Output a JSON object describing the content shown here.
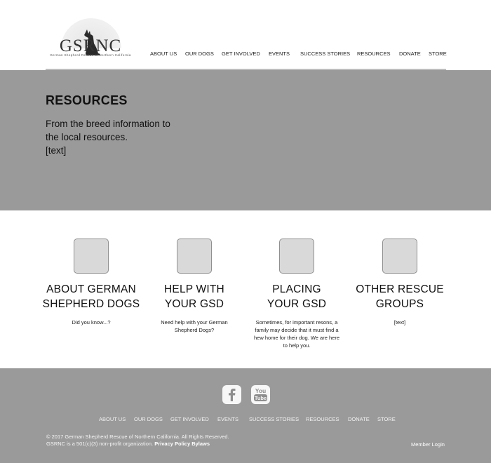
{
  "brand": {
    "logo_text": "GSRNC",
    "logo_subtitle": "German Shepherd Rescue of Northern California"
  },
  "nav": {
    "items": [
      {
        "label": "ABOUT US"
      },
      {
        "label": "OUR DOGS"
      },
      {
        "label": "GET INVOLVED"
      },
      {
        "label": "EVENTS"
      },
      {
        "label": "SUCCESS STORIES"
      },
      {
        "label": "RESOURCES"
      },
      {
        "label": "DONATE"
      },
      {
        "label": "STORE"
      }
    ]
  },
  "hero": {
    "title": "RESOURCES",
    "description": "From the breed information to the local resources.",
    "extra": "[text]"
  },
  "cards": [
    {
      "title_line1": "ABOUT GERMAN",
      "title_line2": "SHEPHERD DOGS",
      "text": "Did you know...?"
    },
    {
      "title_line1": "HELP WITH",
      "title_line2": "YOUR GSD",
      "text": "Need help with your German Shepherd Dogs?"
    },
    {
      "title_line1": "PLACING",
      "title_line2": "YOUR GSD",
      "text": "Sometimes, for important resons, a family may decide that it must find a hew home for their dog. We are here to help you."
    },
    {
      "title_line1": "OTHER RESCUE",
      "title_line2": "GROUPS",
      "text": "[text]"
    }
  ],
  "footer": {
    "social": [
      {
        "icon": "facebook-icon",
        "label": "f"
      },
      {
        "icon": "youtube-icon",
        "label_top": "You",
        "label_bottom": "Tube"
      }
    ],
    "nav": [
      {
        "label": "ABOUT US"
      },
      {
        "label": "OUR DOGS"
      },
      {
        "label": "GET INVOLVED"
      },
      {
        "label": "EVENTS"
      },
      {
        "label": "SUCCESS STORIES"
      },
      {
        "label": "RESOURCES"
      },
      {
        "label": "DONATE"
      },
      {
        "label": "STORE"
      }
    ],
    "copyright": "©  2017 German Shepherd Rescue of Northern California. All Rights Reserved.",
    "nonprofit": "GSRNC is a 501(c)(3) non-profit organization.",
    "privacy_label": "Privacy Policy",
    "bylaws_label": "Bylaws",
    "member_login": "Member Login"
  },
  "colors": {
    "hero_bg": "#9a9a9a",
    "footer_bg": "#9a9a9a",
    "card_icon_bg": "#d9d9d9",
    "page_bg": "#ffffff"
  }
}
